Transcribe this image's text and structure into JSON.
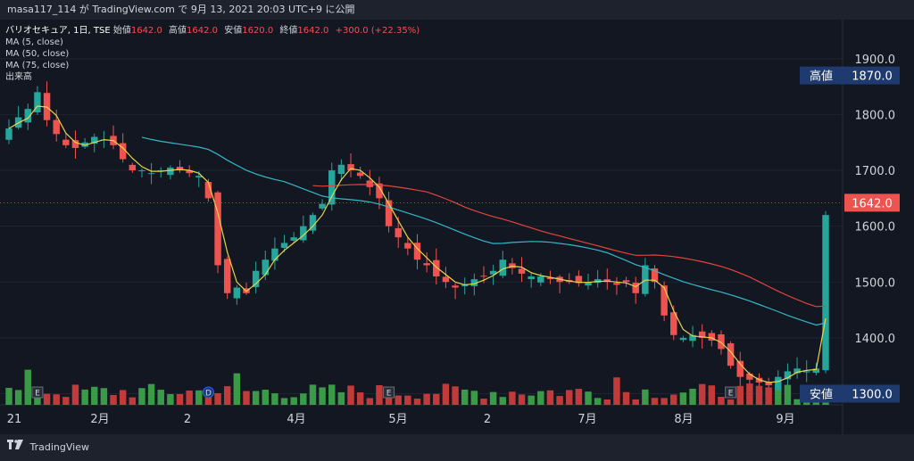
{
  "header": {
    "text": "masa117_114 が TradingView.com で 9月 13, 2021 20:03 UTC+9 に公開"
  },
  "legend": {
    "symbol": "バリオセキュア, 1日, TSE",
    "open_label": "始値",
    "open": "1642.0",
    "high_label": "高値",
    "high": "1642.0",
    "low_label": "安値",
    "low": "1620.0",
    "close_label": "終値",
    "close": "1642.0",
    "change": "+300.0 (+22.35%)",
    "ma5": "MA (5, close)",
    "ma50": "MA (50, close)",
    "ma75": "MA (75, close)",
    "volume": "出来高"
  },
  "footer": {
    "brand": "TradingView"
  },
  "colors": {
    "up": "#26a69a",
    "down": "#ef5350",
    "ma5": "#e8d44d",
    "ma50": "#35b7c8",
    "ma75": "#e0463c",
    "vol_up": "#3a9a48",
    "vol_down": "#c23b3b",
    "label_bg": "#1e3a6e"
  },
  "chart_data": {
    "type": "candlestick",
    "y_ticks": [
      "1900.0",
      "1800.0",
      "1700.0",
      "1600.0",
      "1500.0",
      "1400.0",
      "1300.0"
    ],
    "ylim": [
      1280,
      1970
    ],
    "x_ticks": [
      "21",
      "2月",
      "2",
      "4月",
      "5月",
      "2",
      "7月",
      "8月",
      "9月"
    ],
    "high_marker": {
      "label": "高値",
      "value": "1870.0"
    },
    "low_marker": {
      "label": "安値",
      "value": "1300.0"
    },
    "last_price": "1642.0",
    "event_markers": [
      "E",
      "D",
      "E",
      "E"
    ],
    "close_series": [
      1775,
      1795,
      1810,
      1840,
      1790,
      1765,
      1745,
      1740,
      1750,
      1760,
      1755,
      1745,
      1720,
      1700,
      1700,
      1695,
      1700,
      1705,
      1700,
      1695,
      1690,
      1650,
      1530,
      1480,
      1490,
      1480,
      1520,
      1540,
      1560,
      1570,
      1580,
      1600,
      1620,
      1640,
      1700,
      1710,
      1700,
      1690,
      1670,
      1650,
      1600,
      1580,
      1560,
      1540,
      1530,
      1510,
      1500,
      1490,
      1495,
      1505,
      1510,
      1520,
      1540,
      1525,
      1515,
      1510,
      1510,
      1505,
      1500,
      1500,
      1498,
      1500,
      1505,
      1500,
      1495,
      1500,
      1480,
      1530,
      1500,
      1440,
      1405,
      1400,
      1405,
      1400,
      1395,
      1380,
      1350,
      1330,
      1325,
      1320,
      1315,
      1330,
      1340,
      1345,
      1340,
      1345,
      1620
    ]
  }
}
